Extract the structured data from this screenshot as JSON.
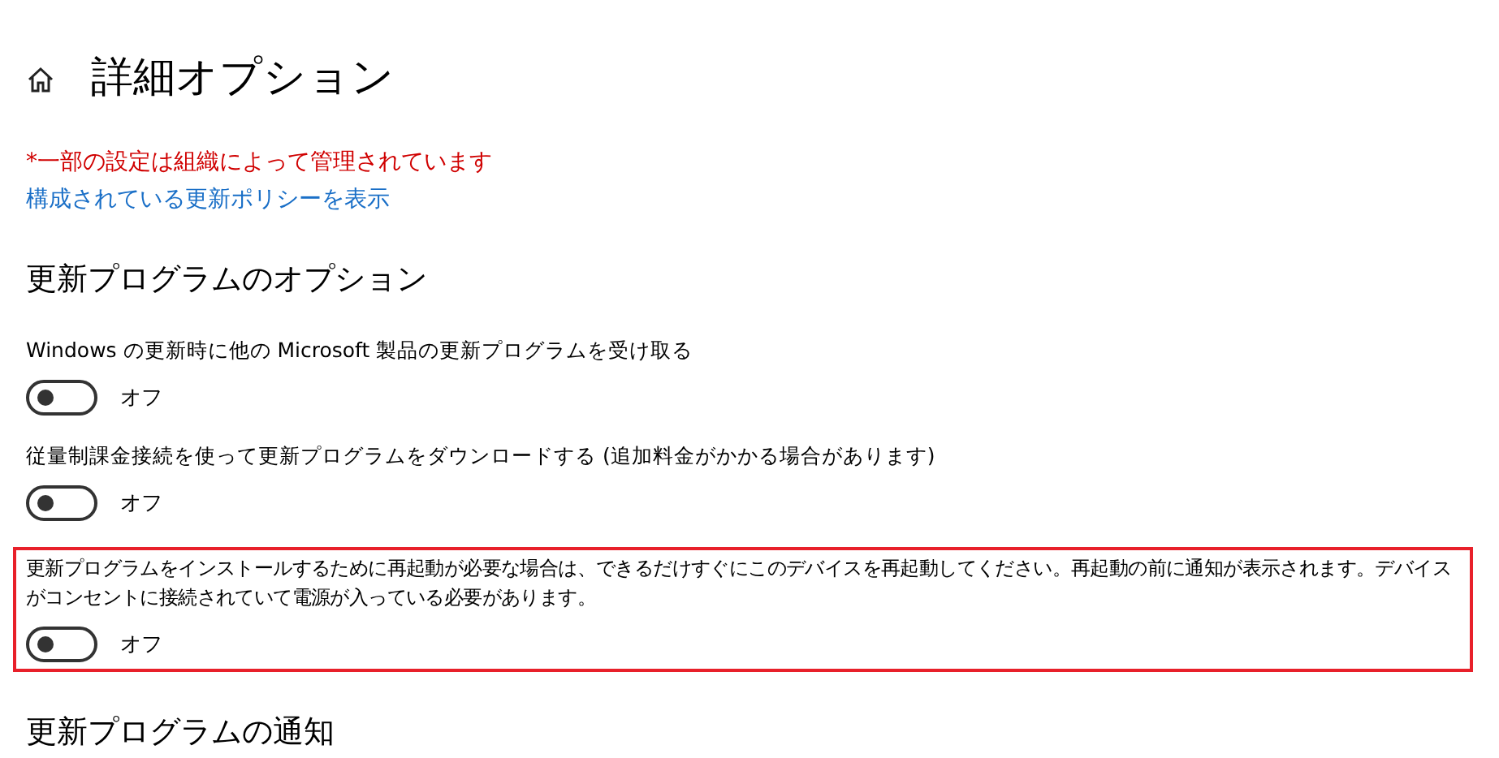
{
  "page": {
    "title": "詳細オプション"
  },
  "notice": {
    "text": "*一部の設定は組織によって管理されています",
    "link": "構成されている更新ポリシーを表示"
  },
  "sections": [
    {
      "heading": "更新プログラムのオプション",
      "options": [
        {
          "label": "Windows の更新時に他の Microsoft 製品の更新プログラムを受け取る",
          "on": false,
          "state": "オフ",
          "highlighted": false
        },
        {
          "label": "従量制課金接続を使って更新プログラムをダウンロードする (追加料金がかかる場合があります)",
          "on": false,
          "state": "オフ",
          "highlighted": false
        },
        {
          "label": "更新プログラムをインストールするために再起動が必要な場合は、できるだけすぐにこのデバイスを再起動してください。再起動の前に通知が表示されます。デバイスがコンセントに接続されていて電源が入っている必要があります。",
          "on": false,
          "state": "オフ",
          "highlighted": true
        }
      ]
    },
    {
      "heading": "更新プログラムの通知"
    }
  ]
}
